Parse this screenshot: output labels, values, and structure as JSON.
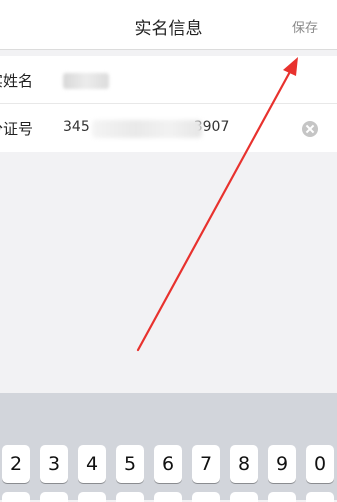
{
  "nav": {
    "title": "实名信息",
    "save_label": "保存"
  },
  "form": {
    "name_label": "实姓名",
    "id_label": "分证号",
    "id_value_prefix": "345",
    "id_value_suffix": "3907"
  },
  "keyboard": {
    "keys": [
      "2",
      "3",
      "4",
      "5",
      "6",
      "7",
      "8",
      "9",
      "0"
    ]
  },
  "colors": {
    "arrow": "#e8322e",
    "background": "#f2f2f4",
    "keyboard": "#d2d5db"
  },
  "icons": [
    "clear-icon",
    "annotation-arrow"
  ]
}
